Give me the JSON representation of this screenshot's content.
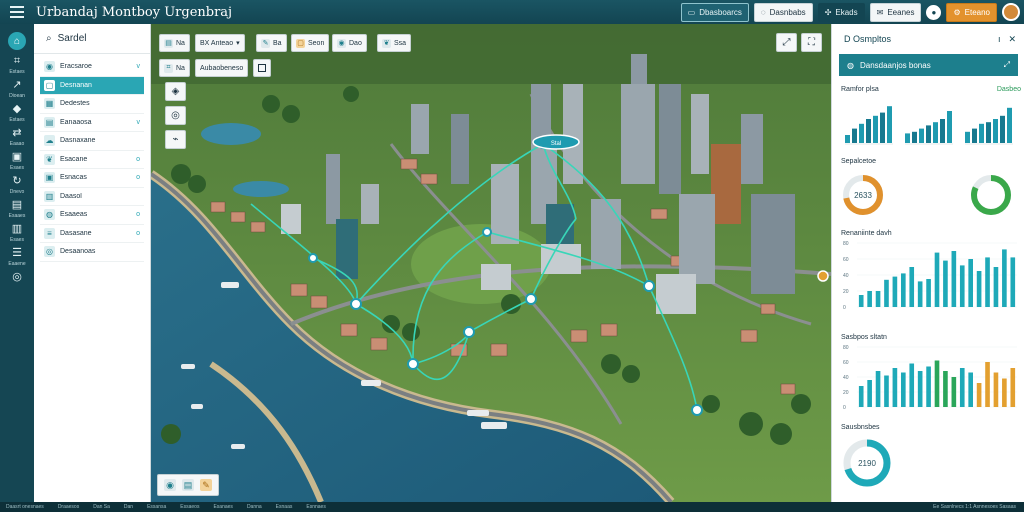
{
  "app": {
    "title": "Urbandaj Montboy Urgenbraj"
  },
  "topbar": {
    "actions": [
      {
        "label": "Dbasboarcs",
        "icon": "monitor-icon"
      },
      {
        "label": "Dasnbabs",
        "icon": "chat-icon"
      },
      {
        "label": "Ekads",
        "icon": "tools-icon"
      },
      {
        "label": "Eeanes",
        "icon": "mail-icon"
      },
      {
        "label": "",
        "icon": "user-circle-icon"
      },
      {
        "label": "Eteano",
        "icon": "gear-icon"
      }
    ]
  },
  "rail": {
    "items": [
      {
        "label": "",
        "icon": "home-icon"
      },
      {
        "label": "Estaes",
        "icon": "grid-icon"
      },
      {
        "label": "Dioean",
        "icon": "route-icon"
      },
      {
        "label": "Estaes",
        "icon": "layers-icon"
      },
      {
        "label": "Eaaao",
        "icon": "share-icon"
      },
      {
        "label": "Esaes",
        "icon": "image-icon"
      },
      {
        "label": "Dnevo",
        "icon": "refresh-icon"
      },
      {
        "label": "Esaaes",
        "icon": "chart-icon"
      },
      {
        "label": "Esaes",
        "icon": "doc-icon"
      },
      {
        "label": "Eaaene",
        "icon": "list-icon"
      },
      {
        "label": "",
        "icon": "globe-icon"
      }
    ]
  },
  "side": {
    "search_label": "Sardel",
    "items": [
      {
        "label": "Eracsaroe",
        "trail": "v"
      },
      {
        "label": "Desnanan",
        "trail": ""
      },
      {
        "label": "Dedestes",
        "trail": ""
      },
      {
        "label": "Eanaaosa",
        "trail": "v"
      },
      {
        "label": "Dasnaxane",
        "trail": ""
      },
      {
        "label": "Esacane",
        "trail": "o"
      },
      {
        "label": "Esnacas",
        "trail": "o"
      },
      {
        "label": "Daasol",
        "trail": ""
      },
      {
        "label": "Esaaeas",
        "trail": "o"
      },
      {
        "label": "Dasasane",
        "trail": "o"
      },
      {
        "label": "Desaanoas",
        "trail": ""
      }
    ]
  },
  "map": {
    "chips_row1": [
      {
        "label": "Na"
      },
      {
        "label": "BX Anteao"
      },
      {
        "label": "Ba"
      },
      {
        "label": "Seon"
      },
      {
        "label": "Dao"
      },
      {
        "label": "Ssa"
      }
    ],
    "chips_row2": [
      {
        "label": "Na"
      },
      {
        "label": "Aubaobeneso"
      },
      {
        "label": ""
      }
    ],
    "marker_label": "Stal"
  },
  "rpanel": {
    "title": "D Osmpltos",
    "tab_label": "Dansdaanjos bonas",
    "cards": [
      {
        "title": "Ramfor plsa",
        "subtitle": "Dasbeo",
        "chart_data": {
          "type": "bar",
          "groups": [
            [
              10,
              18,
              24,
              30,
              34,
              38,
              46
            ],
            [
              12,
              14,
              18,
              22,
              26,
              30,
              40
            ],
            [
              14,
              18,
              24,
              26,
              30,
              34,
              44
            ]
          ],
          "colors": [
            "#1f9bb0",
            "#17798f"
          ]
        }
      },
      {
        "title": "Sepalcetoe",
        "subtitle": "",
        "chart_data": {
          "type": "pie",
          "rings": [
            {
              "label": "2633",
              "pct": 0.72,
              "color": "#e0912d"
            },
            {
              "label": "",
              "pct": 0.82,
              "color": "#3aa84a"
            }
          ]
        }
      },
      {
        "title": "Renaniinte davh",
        "subtitle": "",
        "chart_data": {
          "type": "bar",
          "y_ticks": [
            "80",
            "60",
            "40",
            "20",
            "0"
          ],
          "values": [
            15,
            20,
            20,
            34,
            38,
            42,
            50,
            32,
            35,
            68,
            58,
            70,
            52,
            60,
            45,
            62,
            50,
            72,
            62
          ],
          "color": "#1ea9b8"
        }
      },
      {
        "title": "Sasbpos sltatn",
        "subtitle": "",
        "chart_data": {
          "type": "bar",
          "y_ticks": [
            "80",
            "60",
            "40",
            "20",
            "0"
          ],
          "values": [
            28,
            36,
            48,
            42,
            52,
            46,
            58,
            48,
            54,
            62,
            48,
            40,
            52,
            46,
            32,
            60,
            46,
            38,
            52
          ],
          "colors": [
            "#1ea9b8",
            "#1ea9b8",
            "#1ea9b8",
            "#1ea9b8",
            "#1ea9b8",
            "#1ea9b8",
            "#1ea9b8",
            "#1ea9b8",
            "#1ea9b8",
            "#2aa65a",
            "#2aa65a",
            "#2aa65a",
            "#1ea9b8",
            "#1ea9b8",
            "#e3a030",
            "#e3a030",
            "#e3a030",
            "#e3a030",
            "#e3a030"
          ]
        }
      },
      {
        "title": "Sausbnsbes",
        "subtitle": "",
        "chart_data": {
          "type": "pie",
          "rings": [
            {
              "label": "2190",
              "pct": 0.7,
              "color": "#1ea9b8"
            }
          ]
        }
      }
    ]
  },
  "status": {
    "items": [
      "Daasrt onesnaes",
      "Draaesos",
      "Dan Sa",
      "Dan",
      "Essansa",
      "Essaeos",
      "Esanaes",
      "Danna",
      "Esnaas",
      "Esnnaes"
    ],
    "right": "Ee Sasnlnecs 1:1 Asnnesoes Sasaas"
  }
}
